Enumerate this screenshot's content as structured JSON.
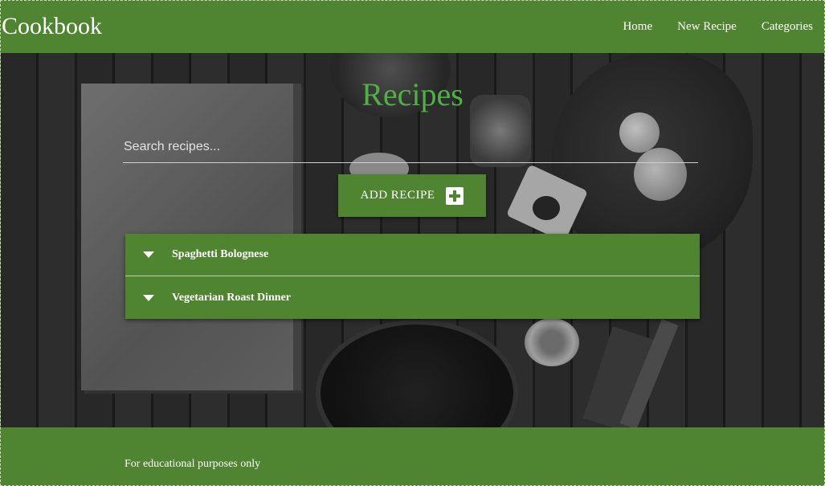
{
  "navbar": {
    "brand": "Cookbook",
    "links": [
      "Home",
      "New Recipe",
      "Categories"
    ]
  },
  "main": {
    "title": "Recipes",
    "search": {
      "placeholder": "Search recipes...",
      "value": ""
    },
    "add_button": {
      "label": "ADD RECIPE",
      "icon": "plus-square-icon"
    },
    "recipes": [
      {
        "name": "Spaghetti Bolognese",
        "icon": "caret-down-icon"
      },
      {
        "name": "Vegetarian Roast Dinner",
        "icon": "caret-down-icon"
      }
    ]
  },
  "footer": {
    "text": "For educational purposes only"
  },
  "colors": {
    "primary": "#4f8530",
    "title_green": "#4fb043",
    "white": "#ffffff"
  }
}
